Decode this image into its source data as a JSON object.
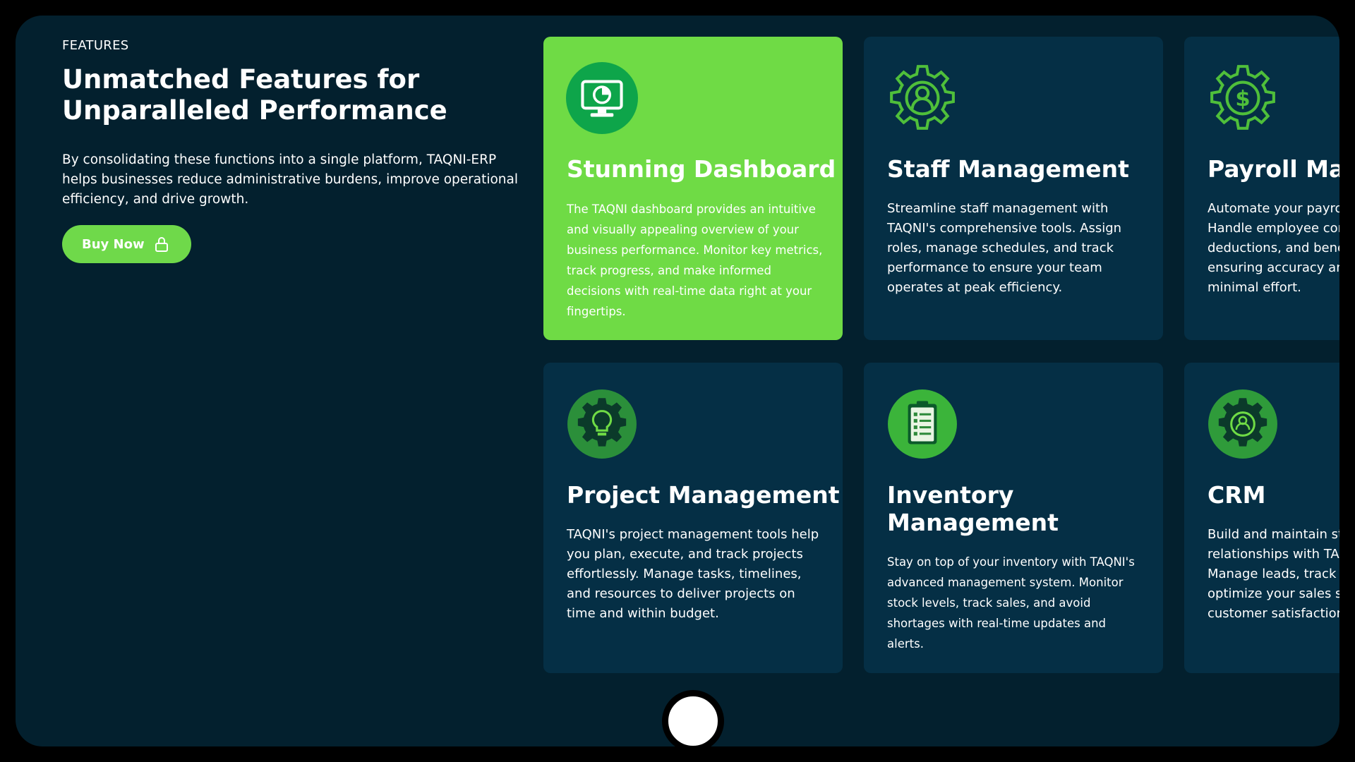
{
  "intro": {
    "eyebrow": "FEATURES",
    "headline": "Unmatched Features for Unparalleled Performance",
    "text": "By consolidating these functions into a single platform, TAQNI-ERP helps businesses reduce administrative burdens, improve operational efficiency, and drive growth.",
    "button_label": "Buy Now"
  },
  "cards": [
    {
      "title": "Stunning Dashboard",
      "desc": "The TAQNI dashboard provides an intuitive and visually appealing overview of your business performance. Monitor key metrics, track progress, and make informed decisions with real-time data right at your fingertips.",
      "icon": "dashboard-monitor-icon"
    },
    {
      "title": "Staff Management",
      "desc": "Streamline staff management with TAQNI's comprehensive tools. Assign roles, manage schedules, and track performance to ensure your team operates at peak efficiency.",
      "icon": "staff-gear-icon"
    },
    {
      "title": "Payroll Man",
      "desc": "Automate your payro Handle employee cor deductions, and bene ensuring accuracy an minimal effort.",
      "icon": "payroll-gear-icon"
    },
    {
      "title": "Project Management",
      "desc": "TAQNI's project management tools help you plan, execute, and track projects effortlessly. Manage tasks, timelines, and resources to deliver projects on time and within budget.",
      "icon": "project-lightbulb-icon"
    },
    {
      "title": "Inventory Management",
      "desc": "Stay on top of your inventory with TAQNI's advanced management system. Monitor stock levels, track sales, and avoid shortages with real-time updates and alerts.",
      "icon": "inventory-clipboard-icon"
    },
    {
      "title": "CRM",
      "desc": "Build and maintain st relationships with TA Manage leads, track i optimize your sales st customer satisfaction",
      "icon": "crm-gear-icon"
    }
  ],
  "colors": {
    "background": "#03202e",
    "card": "#052f45",
    "accent": "#6fdb45"
  }
}
